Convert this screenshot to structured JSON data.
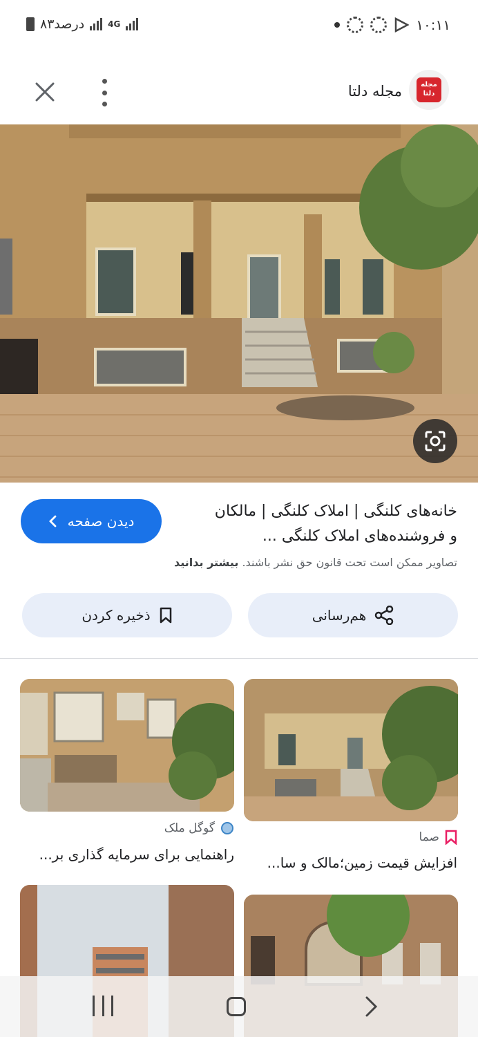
{
  "status_bar": {
    "time": "۱۰:۱۱",
    "battery": "۸۳درصد",
    "network": "4G"
  },
  "header": {
    "site_name": "مجله دلتا",
    "logo_text": "مجله دلتا",
    "icons": [
      "close-icon",
      "more-vert-icon"
    ]
  },
  "result": {
    "title_line1": "خانه‌های کلنگی | املاک کلنگی | مالکان",
    "title_line2": "و فروشنده‌های املاک کلنگی ...",
    "copyright_text": "تصاویر ممکن است تحت قانون حق نشر باشند.",
    "learn_more": "بیشتر بدانید",
    "view_page_label": "دیدن صفحه",
    "share_label": "هم‌رسانی",
    "save_label": "ذخیره کردن"
  },
  "related": [
    {
      "source": "صما",
      "title": "افزایش قیمت زمین؛مالک و سا..."
    },
    {
      "source": "گوگل ملک",
      "title": "راهنمایی برای سرمایه گذاری بر..."
    }
  ],
  "colors": {
    "accent": "#1a73e8",
    "tonal_button": "#e8eef9",
    "brand_red": "#d7262d",
    "source_pink": "#e91e63"
  }
}
